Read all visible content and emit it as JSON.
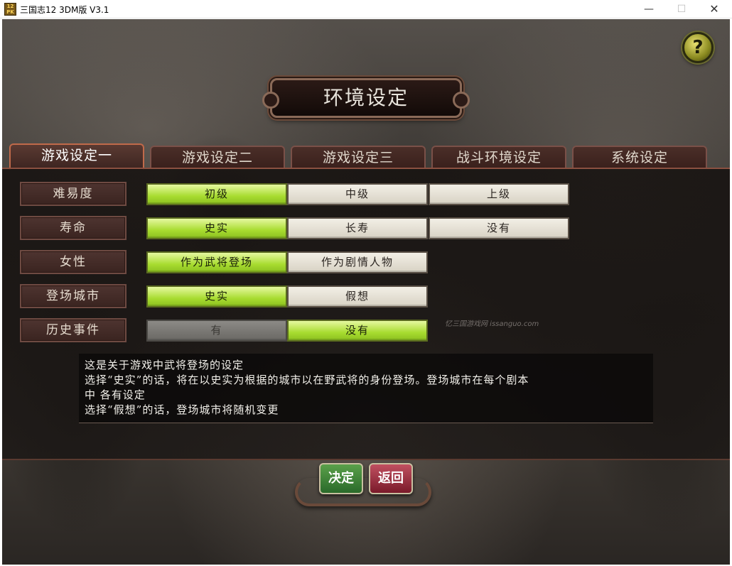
{
  "window": {
    "icon_text": "12 PK",
    "title": "三国志12 3DM版 V3.1",
    "minimize": "—",
    "maximize": "☐",
    "close": "✕"
  },
  "help": {
    "label": "?"
  },
  "page_title": "环境设定",
  "tabs": [
    {
      "label": "游戏设定一",
      "active": true
    },
    {
      "label": "游戏设定二",
      "active": false
    },
    {
      "label": "游戏设定三",
      "active": false
    },
    {
      "label": "战斗环境设定",
      "active": false
    },
    {
      "label": "系统设定",
      "active": false
    }
  ],
  "settings": [
    {
      "label": "难易度",
      "options": [
        "初级",
        "中级",
        "上级"
      ],
      "selected": "初级"
    },
    {
      "label": "寿命",
      "options": [
        "史实",
        "长寿",
        "没有"
      ],
      "selected": "史实"
    },
    {
      "label": "女性",
      "options": [
        "作为武将登场",
        "作为剧情人物"
      ],
      "selected": "作为武将登场"
    },
    {
      "label": "登场城市",
      "options": [
        "史实",
        "假想"
      ],
      "selected": "史实"
    },
    {
      "label": "历史事件",
      "options": [
        "有",
        "没有"
      ],
      "selected": "没有",
      "disabled": [
        "有"
      ]
    }
  ],
  "watermark": "忆三国游戏网 issanguo.com",
  "description": [
    "这是关于游戏中武将登场的设定",
    "选择“史实”的话，将在以史实为根据的城市以在野武将的身份登场。登场城市在每个剧本",
    "中 各有设定",
    "选择“假想”的话，登场城市将随机变更"
  ],
  "buttons": {
    "ok": "决定",
    "back": "返回"
  },
  "colors": {
    "selected": "#a8dc30",
    "tab_active_border": "#c06a4a",
    "ok": "#2a6a2a",
    "back": "#7a1a2a"
  }
}
